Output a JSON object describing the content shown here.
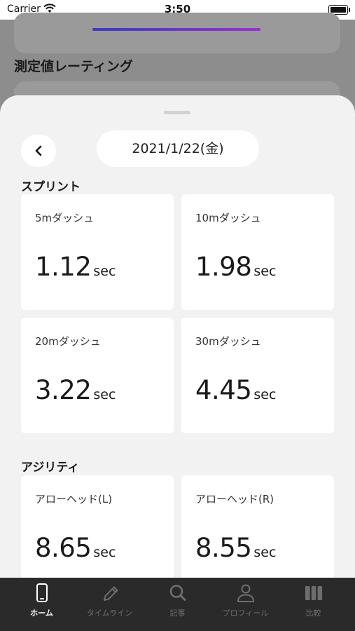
{
  "status_bar": {
    "carrier": "Carrier",
    "time": "3:50"
  },
  "background": {
    "section_title": "測定値レーティング"
  },
  "sheet": {
    "date": "2021/1/22(金)",
    "sections": [
      {
        "title": "スプリント",
        "cards": [
          {
            "label": "5mダッシュ",
            "value": "1.12",
            "unit": "sec"
          },
          {
            "label": "10mダッシュ",
            "value": "1.98",
            "unit": "sec"
          },
          {
            "label": "20mダッシュ",
            "value": "3.22",
            "unit": "sec"
          },
          {
            "label": "30mダッシュ",
            "value": "4.45",
            "unit": "sec"
          }
        ]
      },
      {
        "title": "アジリティ",
        "cards": [
          {
            "label": "アローヘッド(L)",
            "value": "8.65",
            "unit": "sec"
          },
          {
            "label": "アローヘッド(R)",
            "value": "8.55",
            "unit": "sec"
          }
        ]
      }
    ]
  },
  "tab_bar": {
    "tabs": [
      {
        "label": "ホーム",
        "icon": "phone-icon",
        "active": true
      },
      {
        "label": "タイムライン",
        "icon": "pencil-icon",
        "active": false
      },
      {
        "label": "記事",
        "icon": "search-icon",
        "active": false
      },
      {
        "label": "プロフィール",
        "icon": "person-icon",
        "active": false
      },
      {
        "label": "比較",
        "icon": "bars-icon",
        "active": false
      }
    ]
  },
  "colors": {
    "sheet_bg": "#f2f2f2",
    "tabbar_bg": "#2a2a2a",
    "active_tab": "#ffffff",
    "inactive_tab": "#6e6e6e"
  }
}
